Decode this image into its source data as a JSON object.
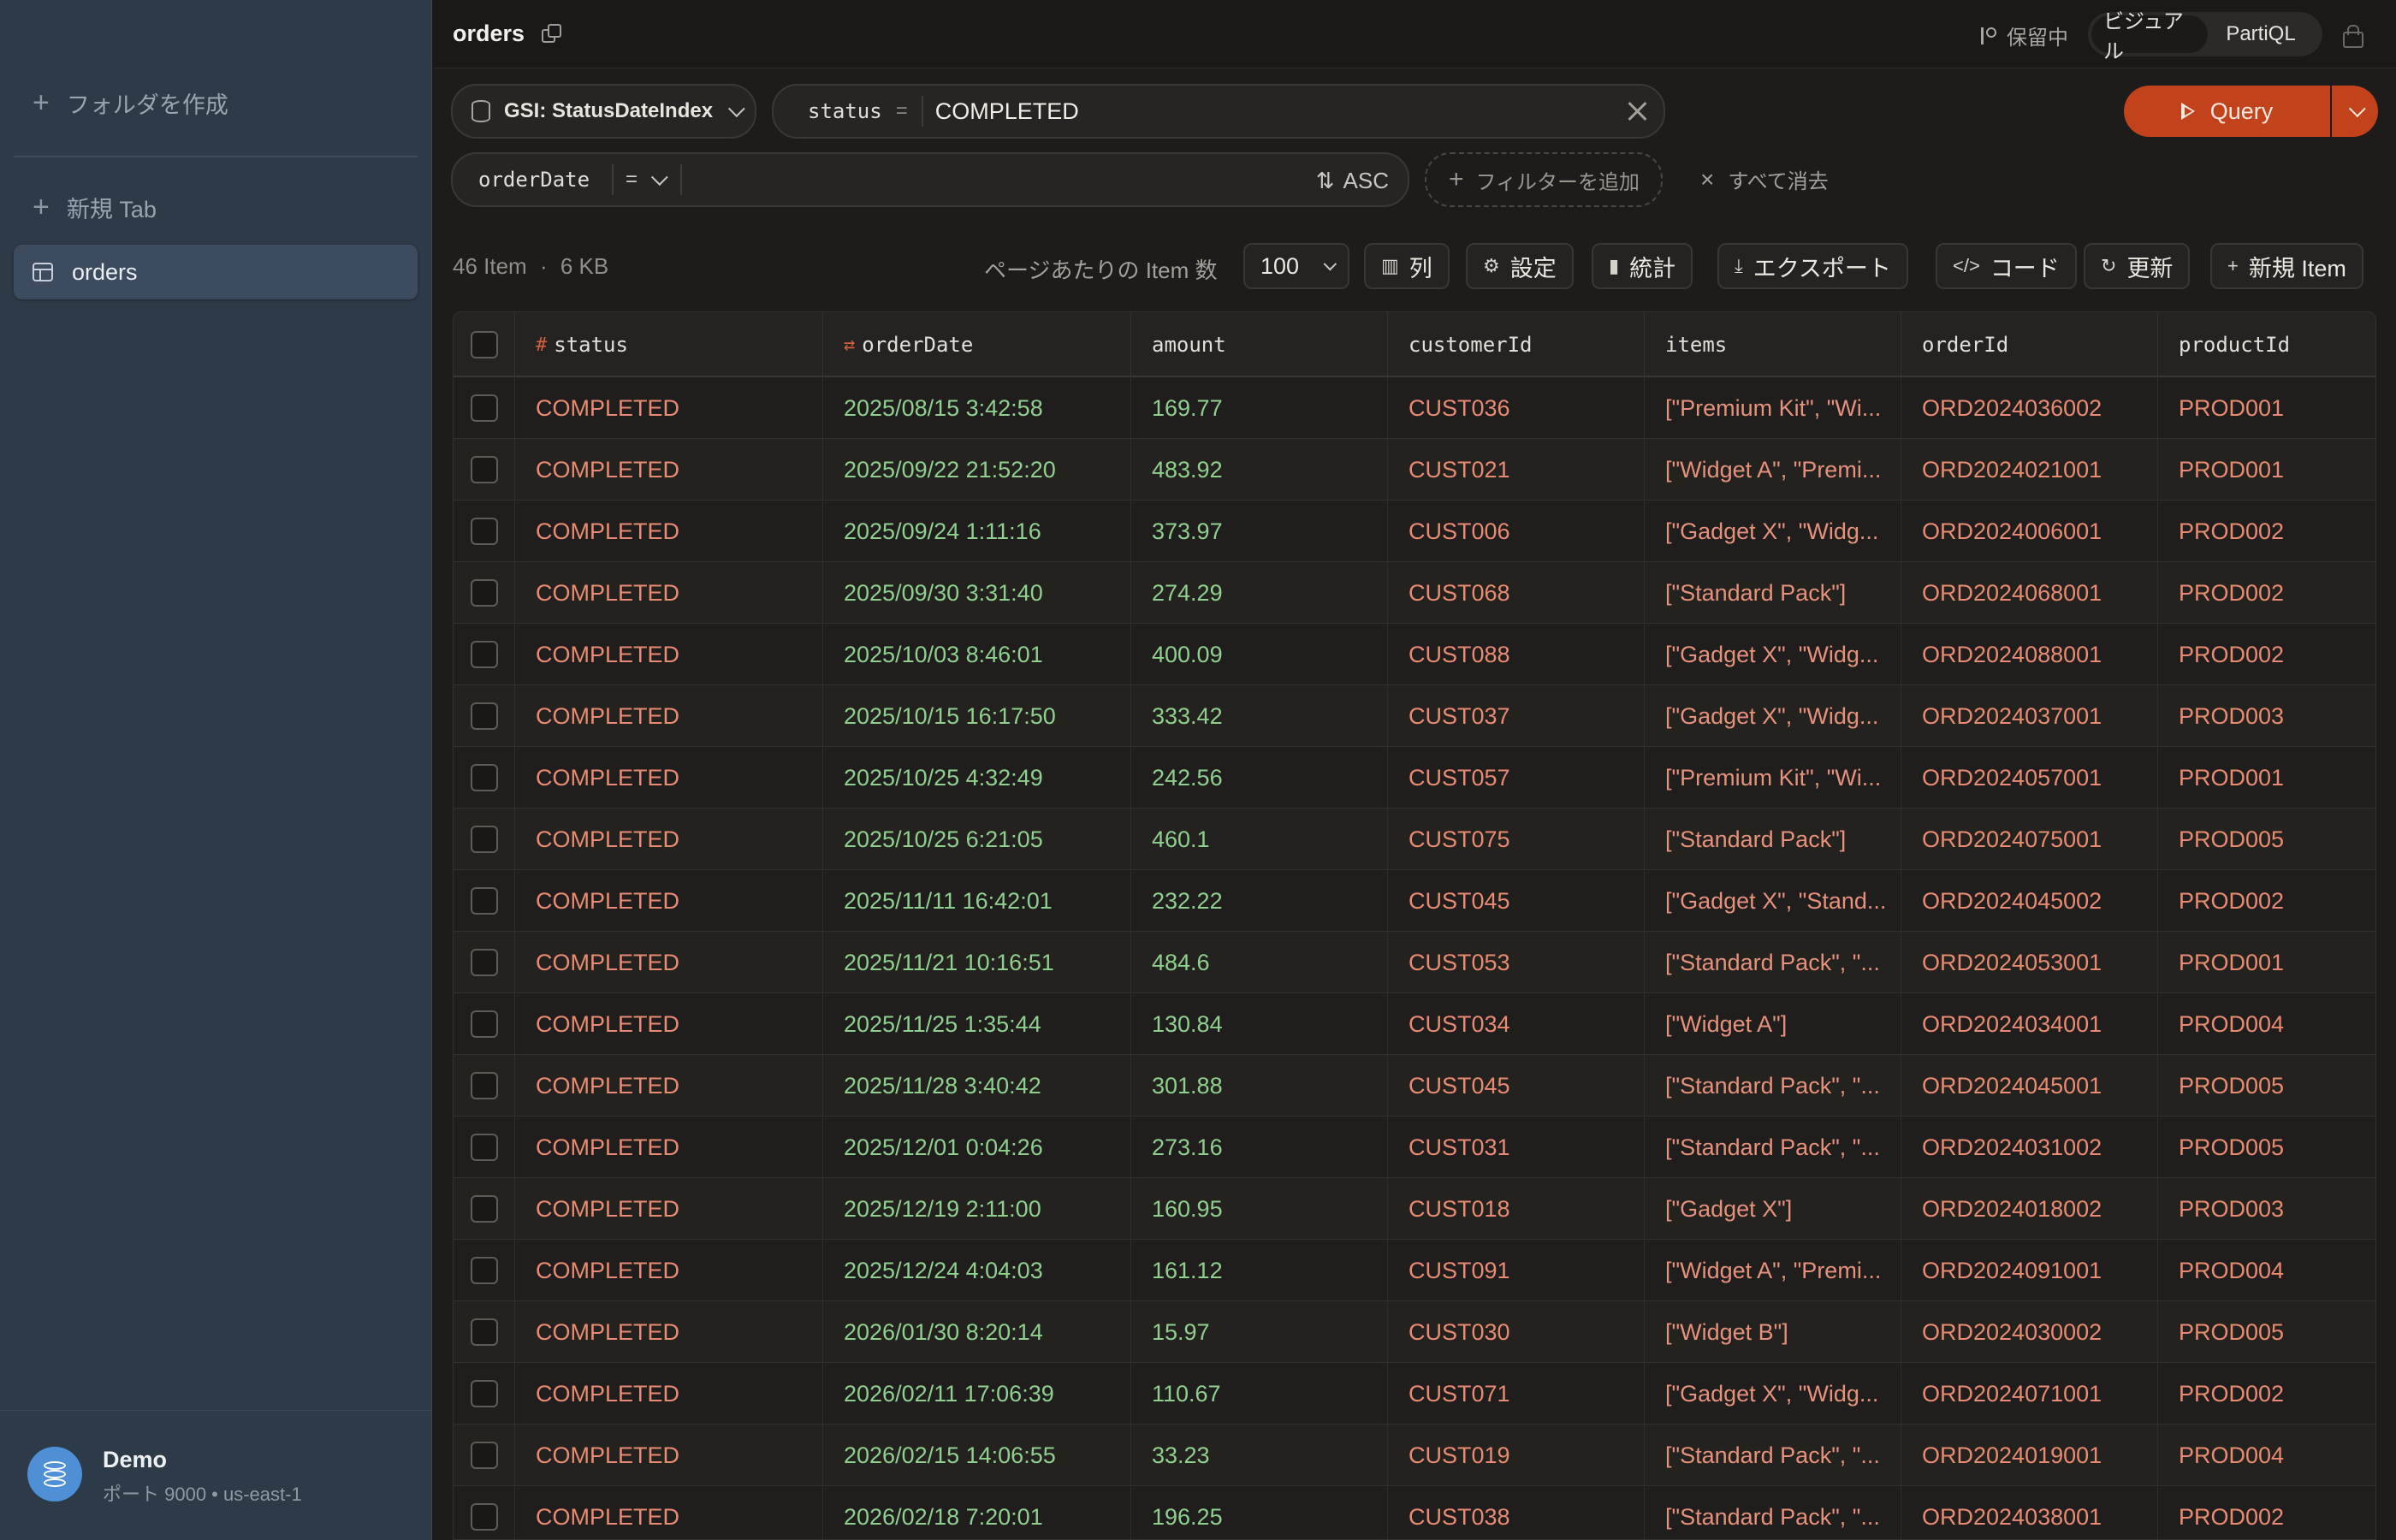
{
  "sidebar": {
    "create_folder": "フォルダを作成",
    "new_tab": "新規 Tab",
    "active_table": "orders",
    "connection": {
      "name": "Demo",
      "detail": "ポート 9000 • us-east-1"
    }
  },
  "topbar": {
    "title": "orders",
    "saving": "保留中",
    "modes": [
      "ビジュアル",
      "PartiQL"
    ],
    "active_mode": "ビジュアル"
  },
  "query": {
    "index": "GSI: StatusDateIndex",
    "pk_key": "status",
    "pk_op": "=",
    "pk_value": "COMPLETED",
    "run_label": "Query",
    "sk_key": "orderDate",
    "sk_op": "=",
    "sk_order": "ASC",
    "add_filter": "フィルターを追加",
    "clear_all": "すべて消去"
  },
  "toolbar": {
    "item_count": "46 Item",
    "size": "6 KB",
    "per_page_label": "ページあたりの Item 数",
    "per_page": "100",
    "columns": "列",
    "settings": "設定",
    "stats": "統計",
    "export": "エクスポート",
    "code": "コード",
    "refresh": "更新",
    "new_item": "新規 Item"
  },
  "table": {
    "columns": [
      {
        "name": "status",
        "tag": "#"
      },
      {
        "name": "orderDate",
        "tag": "⇄"
      },
      {
        "name": "amount",
        "tag": ""
      },
      {
        "name": "customerId",
        "tag": ""
      },
      {
        "name": "items",
        "tag": ""
      },
      {
        "name": "orderId",
        "tag": ""
      },
      {
        "name": "productId",
        "tag": ""
      }
    ],
    "rows": [
      [
        "COMPLETED",
        "2025/08/15 3:42:58",
        "169.77",
        "CUST036",
        "[\"Premium Kit\", \"Wi...",
        "ORD2024036002",
        "PROD001"
      ],
      [
        "COMPLETED",
        "2025/09/22 21:52:20",
        "483.92",
        "CUST021",
        "[\"Widget A\", \"Premi...",
        "ORD2024021001",
        "PROD001"
      ],
      [
        "COMPLETED",
        "2025/09/24 1:11:16",
        "373.97",
        "CUST006",
        "[\"Gadget X\", \"Widg...",
        "ORD2024006001",
        "PROD002"
      ],
      [
        "COMPLETED",
        "2025/09/30 3:31:40",
        "274.29",
        "CUST068",
        "[\"Standard Pack\"]",
        "ORD2024068001",
        "PROD002"
      ],
      [
        "COMPLETED",
        "2025/10/03 8:46:01",
        "400.09",
        "CUST088",
        "[\"Gadget X\", \"Widg...",
        "ORD2024088001",
        "PROD002"
      ],
      [
        "COMPLETED",
        "2025/10/15 16:17:50",
        "333.42",
        "CUST037",
        "[\"Gadget X\", \"Widg...",
        "ORD2024037001",
        "PROD003"
      ],
      [
        "COMPLETED",
        "2025/10/25 4:32:49",
        "242.56",
        "CUST057",
        "[\"Premium Kit\", \"Wi...",
        "ORD2024057001",
        "PROD001"
      ],
      [
        "COMPLETED",
        "2025/10/25 6:21:05",
        "460.1",
        "CUST075",
        "[\"Standard Pack\"]",
        "ORD2024075001",
        "PROD005"
      ],
      [
        "COMPLETED",
        "2025/11/11 16:42:01",
        "232.22",
        "CUST045",
        "[\"Gadget X\", \"Stand...",
        "ORD2024045002",
        "PROD002"
      ],
      [
        "COMPLETED",
        "2025/11/21 10:16:51",
        "484.6",
        "CUST053",
        "[\"Standard Pack\", \"...",
        "ORD2024053001",
        "PROD001"
      ],
      [
        "COMPLETED",
        "2025/11/25 1:35:44",
        "130.84",
        "CUST034",
        "[\"Widget A\"]",
        "ORD2024034001",
        "PROD004"
      ],
      [
        "COMPLETED",
        "2025/11/28 3:40:42",
        "301.88",
        "CUST045",
        "[\"Standard Pack\", \"...",
        "ORD2024045001",
        "PROD005"
      ],
      [
        "COMPLETED",
        "2025/12/01 0:04:26",
        "273.16",
        "CUST031",
        "[\"Standard Pack\", \"...",
        "ORD2024031002",
        "PROD005"
      ],
      [
        "COMPLETED",
        "2025/12/19 2:11:00",
        "160.95",
        "CUST018",
        "[\"Gadget X\"]",
        "ORD2024018002",
        "PROD003"
      ],
      [
        "COMPLETED",
        "2025/12/24 4:04:03",
        "161.12",
        "CUST091",
        "[\"Widget A\", \"Premi...",
        "ORD2024091001",
        "PROD004"
      ],
      [
        "COMPLETED",
        "2026/01/30 8:20:14",
        "15.97",
        "CUST030",
        "[\"Widget B\"]",
        "ORD2024030002",
        "PROD005"
      ],
      [
        "COMPLETED",
        "2026/02/11 17:06:39",
        "110.67",
        "CUST071",
        "[\"Gadget X\", \"Widg...",
        "ORD2024071001",
        "PROD002"
      ],
      [
        "COMPLETED",
        "2026/02/15 14:06:55",
        "33.23",
        "CUST019",
        "[\"Standard Pack\", \"...",
        "ORD2024019001",
        "PROD004"
      ],
      [
        "COMPLETED",
        "2026/02/18 7:20:01",
        "196.25",
        "CUST038",
        "[\"Standard Pack\", \"...",
        "ORD2024038001",
        "PROD002"
      ]
    ]
  }
}
